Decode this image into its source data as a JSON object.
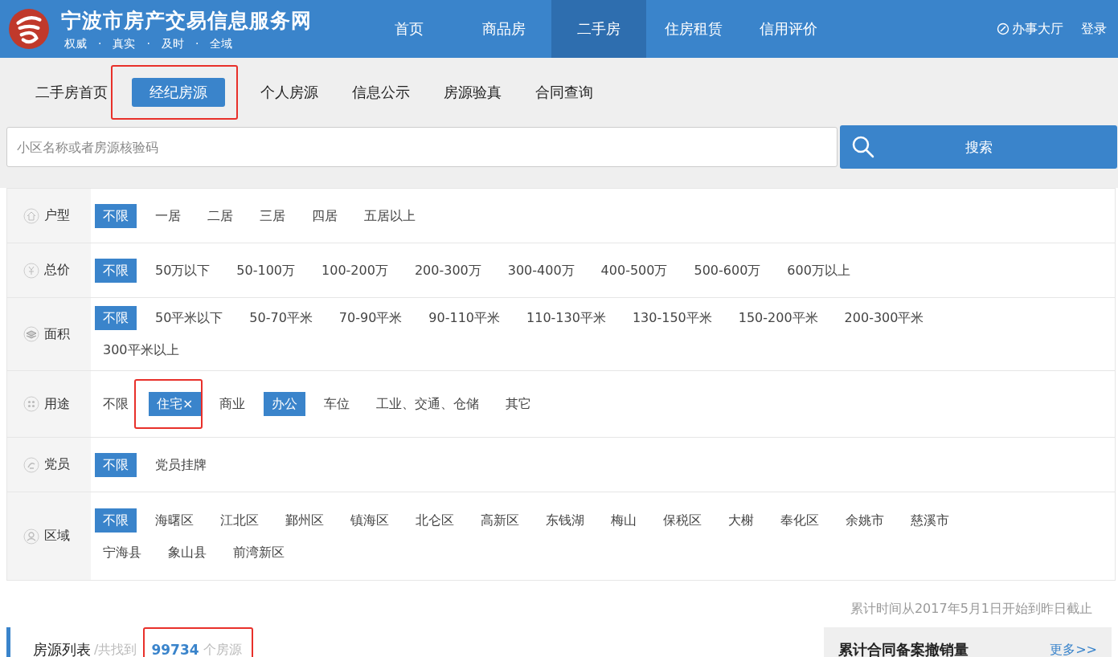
{
  "header": {
    "site_title": "宁波市房产交易信息服务网",
    "slogan": [
      "权威",
      "·",
      "真实",
      "·",
      "及时",
      "·",
      "全域"
    ],
    "nav": [
      {
        "label": "首页",
        "selected": false
      },
      {
        "label": "商品房",
        "selected": false
      },
      {
        "label": "二手房",
        "selected": true
      },
      {
        "label": "住房租赁",
        "selected": false
      },
      {
        "label": "信用评价",
        "selected": false
      }
    ],
    "links": [
      {
        "label": "办事大厅",
        "kind": "hall"
      },
      {
        "label": "登录",
        "kind": "plain"
      }
    ]
  },
  "subnav": [
    {
      "label": "二手房首页",
      "selected": false,
      "highlighted": false
    },
    {
      "label": "经纪房源",
      "selected": true,
      "highlighted": true
    },
    {
      "label": "个人房源",
      "selected": false,
      "highlighted": false
    },
    {
      "label": "信息公示",
      "selected": false,
      "highlighted": false
    },
    {
      "label": "房源验真",
      "selected": false,
      "highlighted": false
    },
    {
      "label": "合同查询",
      "selected": false,
      "highlighted": false
    }
  ],
  "search": {
    "placeholder": "小区名称或者房源核验码",
    "button": "搜索"
  },
  "filters": [
    {
      "label": "户型",
      "options": [
        {
          "label": "不限",
          "selected": true,
          "highlighted": false
        },
        {
          "label": "一居",
          "selected": false,
          "highlighted": false
        },
        {
          "label": "二居",
          "selected": false,
          "highlighted": false
        },
        {
          "label": "三居",
          "selected": false,
          "highlighted": false
        },
        {
          "label": "四居",
          "selected": false,
          "highlighted": false
        },
        {
          "label": "五居以上",
          "selected": false,
          "highlighted": false
        }
      ]
    },
    {
      "label": "总价",
      "options": [
        {
          "label": "不限",
          "selected": true,
          "highlighted": false
        },
        {
          "label": "50万以下",
          "selected": false,
          "highlighted": false
        },
        {
          "label": "50-100万",
          "selected": false,
          "highlighted": false
        },
        {
          "label": "100-200万",
          "selected": false,
          "highlighted": false
        },
        {
          "label": "200-300万",
          "selected": false,
          "highlighted": false
        },
        {
          "label": "300-400万",
          "selected": false,
          "highlighted": false
        },
        {
          "label": "400-500万",
          "selected": false,
          "highlighted": false
        },
        {
          "label": "500-600万",
          "selected": false,
          "highlighted": false
        },
        {
          "label": "600万以上",
          "selected": false,
          "highlighted": false
        }
      ]
    },
    {
      "label": "面积",
      "options": [
        {
          "label": "不限",
          "selected": true,
          "highlighted": false
        },
        {
          "label": "50平米以下",
          "selected": false,
          "highlighted": false
        },
        {
          "label": "50-70平米",
          "selected": false,
          "highlighted": false
        },
        {
          "label": "70-90平米",
          "selected": false,
          "highlighted": false
        },
        {
          "label": "90-110平米",
          "selected": false,
          "highlighted": false
        },
        {
          "label": "110-130平米",
          "selected": false,
          "highlighted": false
        },
        {
          "label": "130-150平米",
          "selected": false,
          "highlighted": false
        },
        {
          "label": "150-200平米",
          "selected": false,
          "highlighted": false
        },
        {
          "label": "200-300平米",
          "selected": false,
          "highlighted": false
        },
        {
          "label": "300平米以上",
          "selected": false,
          "highlighted": false
        }
      ]
    },
    {
      "label": "用途",
      "options": [
        {
          "label": "不限",
          "selected": false,
          "highlighted": false
        },
        {
          "label": "住宅×",
          "selected": true,
          "highlighted": true
        },
        {
          "label": "商业",
          "selected": false,
          "highlighted": false
        },
        {
          "label": "办公",
          "selected": true,
          "highlighted": false
        },
        {
          "label": "车位",
          "selected": false,
          "highlighted": false
        },
        {
          "label": "工业、交通、仓储",
          "selected": false,
          "highlighted": false
        },
        {
          "label": "其它",
          "selected": false,
          "highlighted": false
        }
      ]
    },
    {
      "label": "党员",
      "options": [
        {
          "label": "不限",
          "selected": true,
          "highlighted": false
        },
        {
          "label": "党员挂牌",
          "selected": false,
          "highlighted": false
        }
      ]
    },
    {
      "label": "区域",
      "options": [
        {
          "label": "不限",
          "selected": true,
          "highlighted": false
        },
        {
          "label": "海曙区",
          "selected": false,
          "highlighted": false
        },
        {
          "label": "江北区",
          "selected": false,
          "highlighted": false
        },
        {
          "label": "鄞州区",
          "selected": false,
          "highlighted": false
        },
        {
          "label": "镇海区",
          "selected": false,
          "highlighted": false
        },
        {
          "label": "北仑区",
          "selected": false,
          "highlighted": false
        },
        {
          "label": "高新区",
          "selected": false,
          "highlighted": false
        },
        {
          "label": "东钱湖",
          "selected": false,
          "highlighted": false
        },
        {
          "label": "梅山",
          "selected": false,
          "highlighted": false
        },
        {
          "label": "保税区",
          "selected": false,
          "highlighted": false
        },
        {
          "label": "大榭",
          "selected": false,
          "highlighted": false
        },
        {
          "label": "奉化区",
          "selected": false,
          "highlighted": false
        },
        {
          "label": "余姚市",
          "selected": false,
          "highlighted": false
        },
        {
          "label": "慈溪市",
          "selected": false,
          "highlighted": false
        },
        {
          "label": "宁海县",
          "selected": false,
          "highlighted": false
        },
        {
          "label": "象山县",
          "selected": false,
          "highlighted": false
        },
        {
          "label": "前湾新区",
          "selected": false,
          "highlighted": false
        }
      ]
    }
  ],
  "results": {
    "title": "房源列表",
    "found_prefix": "/共找到",
    "count": "99734",
    "suffix": "个房源",
    "highlighted": true
  },
  "side": {
    "note": "累计时间从2017年5月1日开始到昨日截止",
    "panel_title": "累计合同备案撤销量",
    "more": "更多>>"
  }
}
